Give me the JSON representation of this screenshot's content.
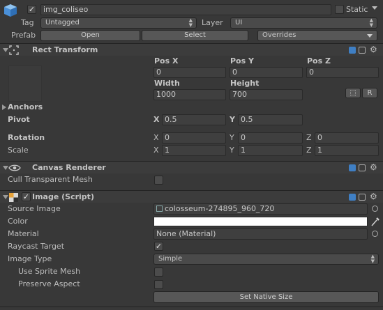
{
  "object": {
    "name": "img_coliseo",
    "static_label": "Static"
  },
  "tag": {
    "label": "Tag",
    "value": "Untagged"
  },
  "layer": {
    "label": "Layer",
    "value": "UI"
  },
  "prefab": {
    "label": "Prefab",
    "open": "Open",
    "select": "Select",
    "overrides": "Overrides"
  },
  "rect": {
    "title": "Rect Transform",
    "posx_label": "Pos X",
    "posy_label": "Pos Y",
    "posz_label": "Pos Z",
    "posx": "0",
    "posy": "0",
    "posz": "0",
    "width_label": "Width",
    "height_label": "Height",
    "width": "1000",
    "height": "700",
    "r_button": "R",
    "anchors": "Anchors",
    "pivot": "Pivot",
    "pivot_x_label": "X",
    "pivot_x": "0.5",
    "pivot_y_label": "Y",
    "pivot_y": "0.5",
    "rotation": "Rotation",
    "rot_x_label": "X",
    "rot_x": "0",
    "rot_y_label": "Y",
    "rot_y": "0",
    "rot_z_label": "Z",
    "rot_z": "0",
    "scale": "Scale",
    "sc_x_label": "X",
    "sc_x": "1",
    "sc_y_label": "Y",
    "sc_y": "1",
    "sc_z_label": "Z",
    "sc_z": "1"
  },
  "canvas": {
    "title": "Canvas Renderer",
    "cull_label": "Cull Transparent Mesh"
  },
  "image": {
    "title": "Image (Script)",
    "source_label": "Source Image",
    "source_value": "colosseum-274895_960_720",
    "color_label": "Color",
    "material_label": "Material",
    "material_value": "None (Material)",
    "raycast_label": "Raycast Target",
    "type_label": "Image Type",
    "type_value": "Simple",
    "sprite_mesh_label": "Use Sprite Mesh",
    "preserve_label": "Preserve Aspect",
    "native_button": "Set Native Size"
  },
  "colors": {
    "background": "#383838",
    "header": "#3c3c3c",
    "field": "#3f3f3f",
    "image_color": "#ffffff",
    "cube_icon": "#4a90d9"
  }
}
